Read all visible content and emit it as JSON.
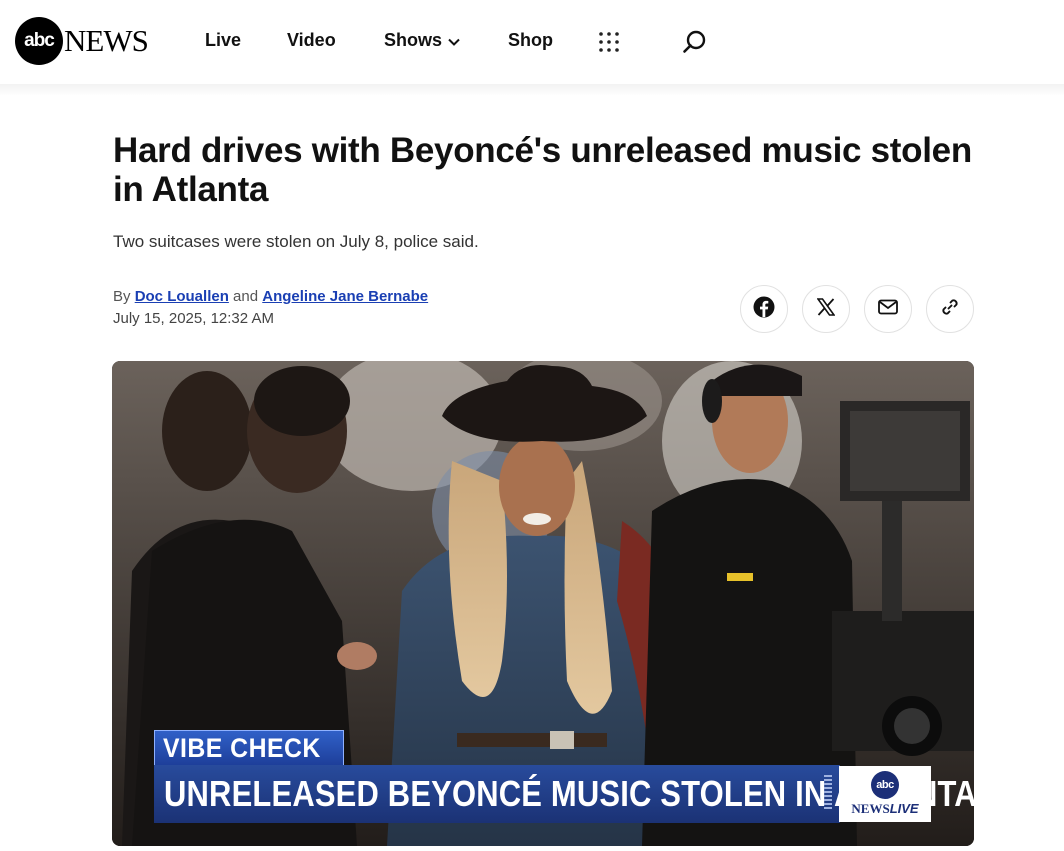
{
  "header": {
    "logo_mark": "abc",
    "logo_word": "NEWS",
    "nav": {
      "live": "Live",
      "video": "Video",
      "shows": "Shows",
      "shop": "Shop"
    },
    "icons": [
      "chevron-down-icon",
      "grid-menu-icon",
      "search-icon"
    ]
  },
  "article": {
    "headline": "Hard drives with Beyoncé's unreleased music stolen in Atlanta",
    "subhead": "Two suitcases were stolen on July 8, police said.",
    "byline": {
      "prefix": "By",
      "author1": "Doc Louallen",
      "joiner": "and",
      "author2": "Angeline Jane Bernabe"
    },
    "date": "July 15, 2025, 12:32 AM"
  },
  "share": {
    "icons": [
      "facebook-icon",
      "x-icon",
      "email-icon",
      "link-icon"
    ]
  },
  "hero": {
    "segment_label": "VIBE CHECK",
    "banner_text": "UNRELEASED BEYONCÉ MUSIC STOLEN IN ATLANTA",
    "badge_mark": "abc",
    "badge_news": "NEWS",
    "badge_live": "LIVE"
  },
  "colors": {
    "link": "#1a3fb3",
    "banner": "#1b3275",
    "badge": "#1c2f78"
  }
}
